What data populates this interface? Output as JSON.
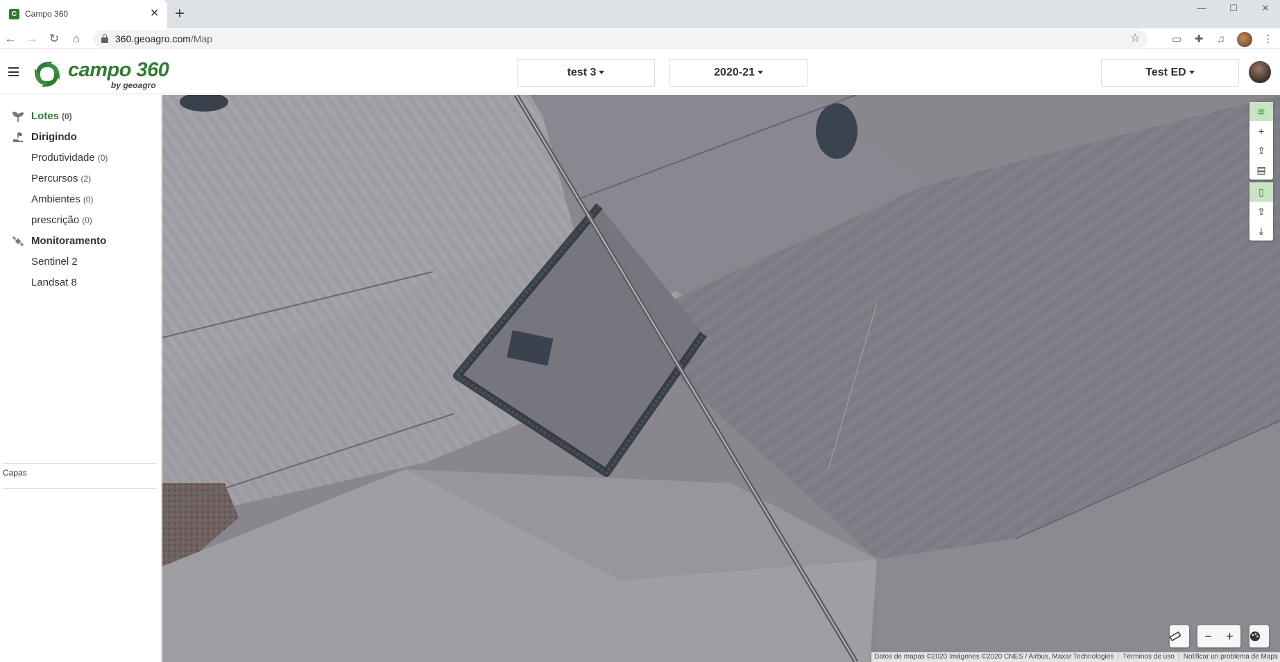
{
  "browser": {
    "tab_title": "Campo 360",
    "url_domain": "360.geoagro.com",
    "url_path": "/Map",
    "window_controls": [
      "minimize-icon",
      "maximize-icon",
      "close-icon"
    ]
  },
  "header": {
    "logo_text": "campo 360",
    "logo_subtext": "by geoagro",
    "field_select": "test 3",
    "season_select": "2020-21",
    "user_select": "Test ED"
  },
  "sidebar": {
    "lotes": {
      "label": "Lotes",
      "count": "(0)"
    },
    "dirigindo": {
      "label": "Dirigindo"
    },
    "produtividade": {
      "label": "Produtividade",
      "count": "(0)"
    },
    "percursos": {
      "label": "Percursos",
      "count": "(2)"
    },
    "ambientes": {
      "label": "Ambientes",
      "count": "(0)"
    },
    "prescricao": {
      "label": "prescrição",
      "count": "(0)"
    },
    "monitoramento": {
      "label": "Monitoramento"
    },
    "sentinel": {
      "label": "Sentinel 2"
    },
    "landsat": {
      "label": "Landsat 8"
    },
    "capas": "Capas"
  },
  "map": {
    "attribution": "Datos de mapas ©2020 Imágenes ©2020 CNES / Airbus, Maxar Technologies",
    "terms": "Términos de uso",
    "report": "Notificar un problema de Maps",
    "tools_top": [
      "layers-icon",
      "plus-icon",
      "upload-icon",
      "file-icon"
    ],
    "tools_mid": [
      "mobile-icon",
      "upload-icon",
      "download-icon"
    ],
    "bottom": {
      "ruler": "ruler-icon",
      "zoom_out": "−",
      "zoom_in": "+",
      "palette": "palette-icon"
    }
  }
}
